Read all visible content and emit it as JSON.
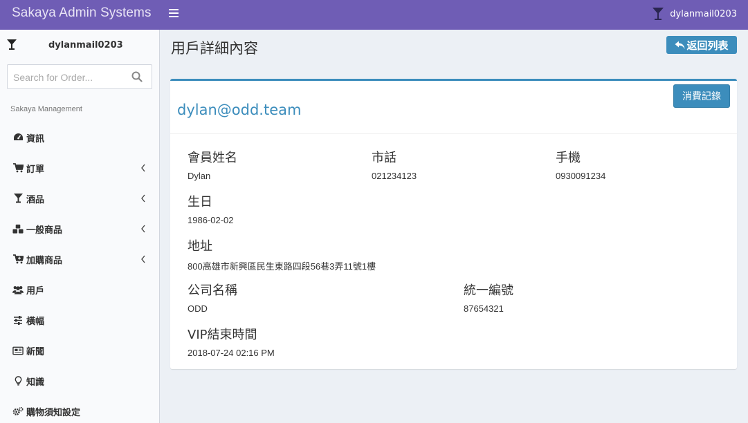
{
  "header": {
    "brand": "Sakaya Admin Systems",
    "username": "dylanmail0203"
  },
  "sidebar": {
    "username": "dylanmail0203",
    "search_placeholder": "Search for Order...",
    "section_header": "Sakaya Management",
    "items": [
      {
        "label": "資訊",
        "icon": "dashboard-icon",
        "has_submenu": false
      },
      {
        "label": "訂單",
        "icon": "cart-icon",
        "has_submenu": true
      },
      {
        "label": "酒品",
        "icon": "glass-icon",
        "has_submenu": true
      },
      {
        "label": "一般商品",
        "icon": "cubes-icon",
        "has_submenu": true
      },
      {
        "label": "加購商品",
        "icon": "cart-plus-icon",
        "has_submenu": true
      },
      {
        "label": "用戶",
        "icon": "users-icon",
        "has_submenu": false
      },
      {
        "label": "橫幅",
        "icon": "sliders-icon",
        "has_submenu": false
      },
      {
        "label": "新聞",
        "icon": "newspaper-icon",
        "has_submenu": false
      },
      {
        "label": "知識",
        "icon": "lightbulb-icon",
        "has_submenu": false
      },
      {
        "label": "購物須知設定",
        "icon": "cogs-icon",
        "has_submenu": false
      }
    ]
  },
  "main": {
    "page_title": "用戶詳細內容",
    "back_label": "返回列表",
    "email": "dylan@odd.team",
    "records_label": "消費記錄",
    "fields": {
      "name": {
        "label": "會員姓名",
        "value": "Dylan"
      },
      "phone": {
        "label": "市話",
        "value": "021234123"
      },
      "mobile": {
        "label": "手機",
        "value": "0930091234"
      },
      "birthday": {
        "label": "生日",
        "value": "1986-02-02"
      },
      "address": {
        "label": "地址",
        "value": "800高雄市新興區民生東路四段56巷3弄11號1樓"
      },
      "company": {
        "label": "公司名稱",
        "value": "ODD"
      },
      "tax_id": {
        "label": "統一編號",
        "value": "87654321"
      },
      "vip_end": {
        "label": "VIP結束時間",
        "value": "2018-07-24 02:16 PM"
      }
    }
  },
  "colors": {
    "navbar": "#6f5db5",
    "primary": "#3c8dbc",
    "sidebar_bg": "#f9fafc",
    "content_bg": "#ecf0f5"
  }
}
